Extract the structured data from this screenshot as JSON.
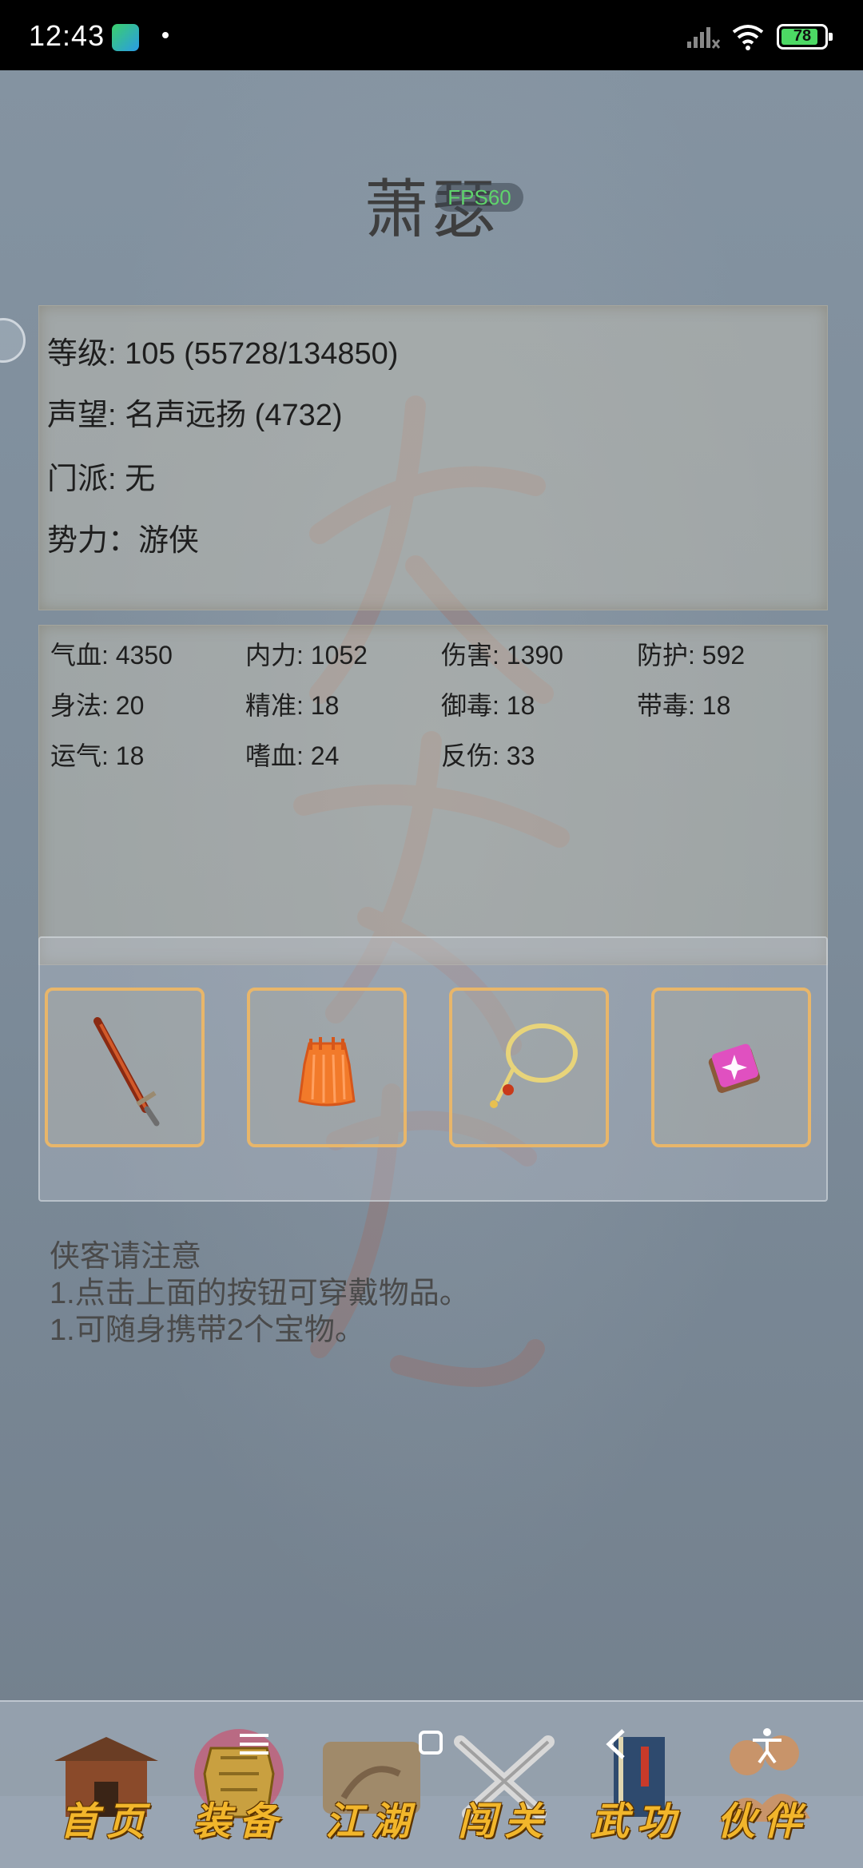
{
  "status_bar": {
    "time": "12:43",
    "battery": "78",
    "colors": {
      "battery_fill": "#4cd964"
    }
  },
  "header": {
    "title": "萧瑟",
    "fps": "FPS60"
  },
  "character_info": [
    "等级: 105 (55728/134850)",
    "声望: 名声远扬 (4732)",
    "门派: 无",
    "势力：游侠"
  ],
  "stats": [
    [
      "气血: 4350",
      "内力: 1052",
      "伤害: 1390",
      "防护: 592"
    ],
    [
      "身法: 20",
      "精准: 18",
      "御毒: 18",
      "带毒: 18"
    ],
    [
      "运气: 18",
      "嗜血: 24",
      "反伤: 33"
    ]
  ],
  "equipment_slots": [
    {
      "icon": "sword-icon"
    },
    {
      "icon": "armor-icon"
    },
    {
      "icon": "necklace-icon"
    },
    {
      "icon": "treasure-icon"
    }
  ],
  "notice": {
    "title": "侠客请注意",
    "lines": [
      "1.点击上面的按钮可穿戴物品。",
      "1.可随身携带2个宝物。"
    ]
  },
  "bottom_nav": [
    {
      "label": "首页",
      "icon": "house-icon"
    },
    {
      "label": "装备",
      "icon": "armor-icon"
    },
    {
      "label": "江湖",
      "icon": "scroll-map-icon"
    },
    {
      "label": "闯关",
      "icon": "crossed-swords-icon"
    },
    {
      "label": "武功",
      "icon": "book-icon"
    },
    {
      "label": "伙伴",
      "icon": "companions-icon"
    }
  ],
  "colors": {
    "background": "#7e8d9b",
    "slot_border": "#e8b66a",
    "nav_label": "#f2b62b",
    "fps_text": "#5fd46c"
  }
}
